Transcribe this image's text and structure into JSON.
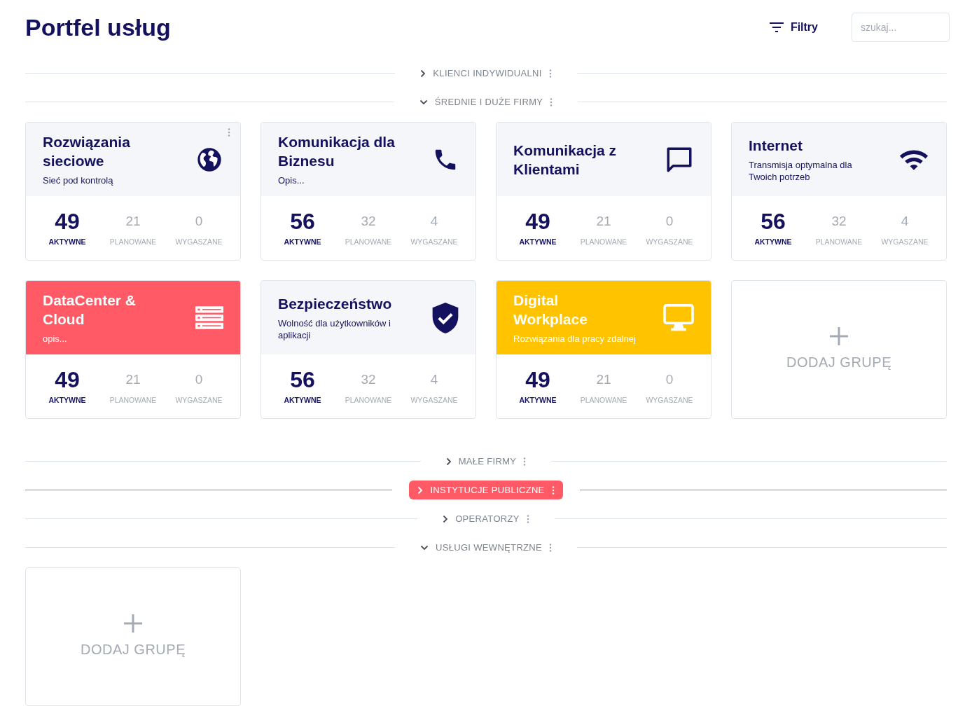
{
  "header": {
    "title": "Portfel usług",
    "filters_label": "Filtry",
    "search": {
      "placeholder": "szukaj..."
    }
  },
  "sections": [
    {
      "label": "KLIENCI INDYWIDUALNI",
      "expanded": false,
      "selected": false
    },
    {
      "label": "ŚREDNIE I DUŻE FIRMY",
      "expanded": true,
      "selected": false,
      "add_label": "DODAJ GRUPĘ",
      "groups": [
        {
          "title": "Rozwiązania sieciowe",
          "subtitle": "Sieć pod kontrolą",
          "kind": "globe",
          "color": "#f4f6fa",
          "menu_visible": true,
          "stats": [
            {
              "value": "49",
              "label": "AKTYWNE",
              "kind": "active"
            },
            {
              "value": "21",
              "label": "PLANOWANE",
              "kind": "other"
            },
            {
              "value": "0",
              "label": "WYGASZANE",
              "kind": "other"
            }
          ]
        },
        {
          "title": "Komunikacja dla Biznesu",
          "subtitle": "Opis...",
          "kind": "phone",
          "color": "#f4f6fa",
          "menu_visible": false,
          "stats": [
            {
              "value": "56",
              "label": "AKTYWNE",
              "kind": "active"
            },
            {
              "value": "32",
              "label": "PLANOWANE",
              "kind": "other"
            },
            {
              "value": "4",
              "label": "WYGASZANE",
              "kind": "other"
            }
          ]
        },
        {
          "title": "Komunikacja z Klientami",
          "kind": "chat",
          "color": "#f4f6fa",
          "menu_visible": false,
          "stats": [
            {
              "value": "49",
              "label": "AKTYWNE",
              "kind": "active"
            },
            {
              "value": "21",
              "label": "PLANOWANE",
              "kind": "other"
            },
            {
              "value": "0",
              "label": "WYGASZANE",
              "kind": "other"
            }
          ]
        },
        {
          "title": "Internet",
          "subtitle": "Transmisja optymalna dla Twoich potrzeb",
          "kind": "wifi",
          "color": "#f4f6fa",
          "menu_visible": false,
          "stats": [
            {
              "value": "56",
              "label": "AKTYWNE",
              "kind": "active"
            },
            {
              "value": "32",
              "label": "PLANOWANE",
              "kind": "other"
            },
            {
              "value": "4",
              "label": "WYGASZANE",
              "kind": "other"
            }
          ]
        },
        {
          "title": "DataCenter & Cloud",
          "subtitle": "opis...",
          "kind": "server",
          "color": "#ff5a66",
          "menu_visible": false,
          "stats": [
            {
              "value": "49",
              "label": "AKTYWNE",
              "kind": "active"
            },
            {
              "value": "21",
              "label": "PLANOWANE",
              "kind": "other"
            },
            {
              "value": "0",
              "label": "WYGASZANE",
              "kind": "other"
            }
          ]
        },
        {
          "title": "Bezpieczeństwo",
          "subtitle": "Wolność dla użytkowników i aplikacji",
          "kind": "shield",
          "color": "#f4f6fa",
          "menu_visible": false,
          "stats": [
            {
              "value": "56",
              "label": "AKTYWNE",
              "kind": "active"
            },
            {
              "value": "32",
              "label": "PLANOWANE",
              "kind": "other"
            },
            {
              "value": "4",
              "label": "WYGASZANE",
              "kind": "other"
            }
          ]
        },
        {
          "title": "Digital Workplace",
          "subtitle": "Rozwiązania dla pracy zdalnej",
          "kind": "monitor",
          "color": "#ffc300",
          "menu_visible": false,
          "stats": [
            {
              "value": "49",
              "label": "AKTYWNE",
              "kind": "active"
            },
            {
              "value": "21",
              "label": "PLANOWANE",
              "kind": "other"
            },
            {
              "value": "0",
              "label": "WYGASZANE",
              "kind": "other"
            }
          ]
        }
      ]
    },
    {
      "label": "MAŁE FIRMY",
      "expanded": false,
      "selected": false
    },
    {
      "label": "INSTYTUCJE PUBLICZNE",
      "expanded": false,
      "selected": true
    },
    {
      "label": "OPERATORZY",
      "expanded": false,
      "selected": false
    },
    {
      "label": "USŁUGI WEWNĘTRZNE",
      "expanded": true,
      "selected": false,
      "add_label": "DODAJ GRUPĘ"
    }
  ]
}
